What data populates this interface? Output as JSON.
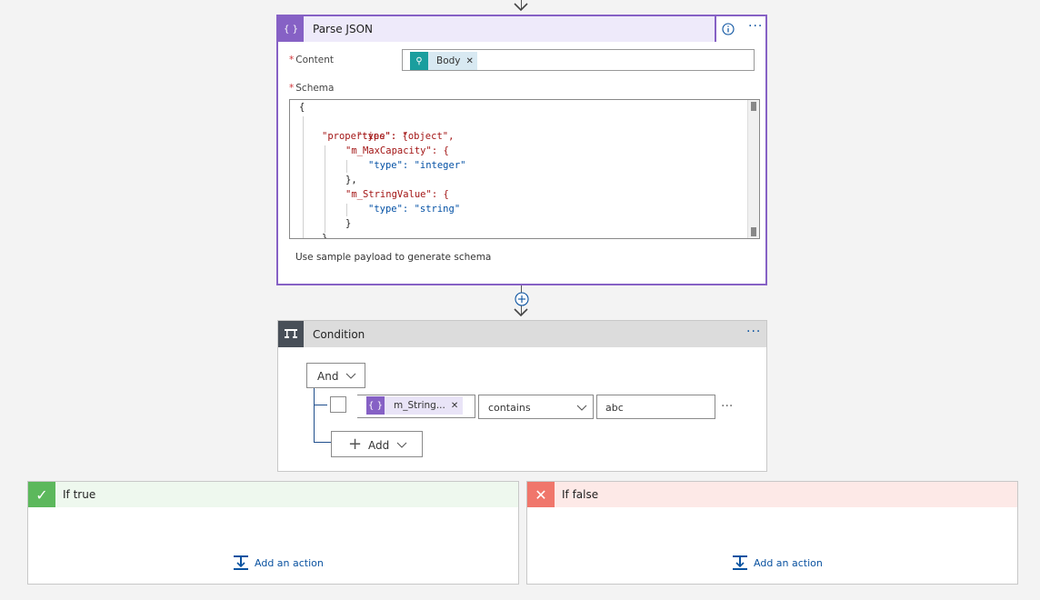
{
  "parse_json": {
    "title": "Parse JSON",
    "content_label": "Content",
    "content_token": "Body",
    "schema_label": "Schema",
    "schema_lines": [
      "{",
      "\"type\": \"object\",",
      "\"properties\": {",
      "\"m_MaxCapacity\": {",
      "\"type\": \"integer\"",
      "},",
      "\"m_StringValue\": {",
      "\"type\": \"string\"",
      "}",
      "}"
    ],
    "sample_link": "Use sample payload to generate schema",
    "info_icon": "info-icon",
    "more_icon": "ellipsis-icon"
  },
  "condition": {
    "title": "Condition",
    "group_operator": "And",
    "row": {
      "left_token": "m_String...",
      "operator": "contains",
      "value": "abc"
    },
    "add_label": "Add"
  },
  "if_true": {
    "title": "If true",
    "add_action": "Add an action"
  },
  "if_false": {
    "title": "If false",
    "add_action": "Add an action"
  },
  "colors": {
    "parse_accent": "#8661c5",
    "condition_accent": "#484f58",
    "true_accent": "#5cb85c",
    "false_accent": "#f0766b",
    "link": "#0a52a0"
  }
}
